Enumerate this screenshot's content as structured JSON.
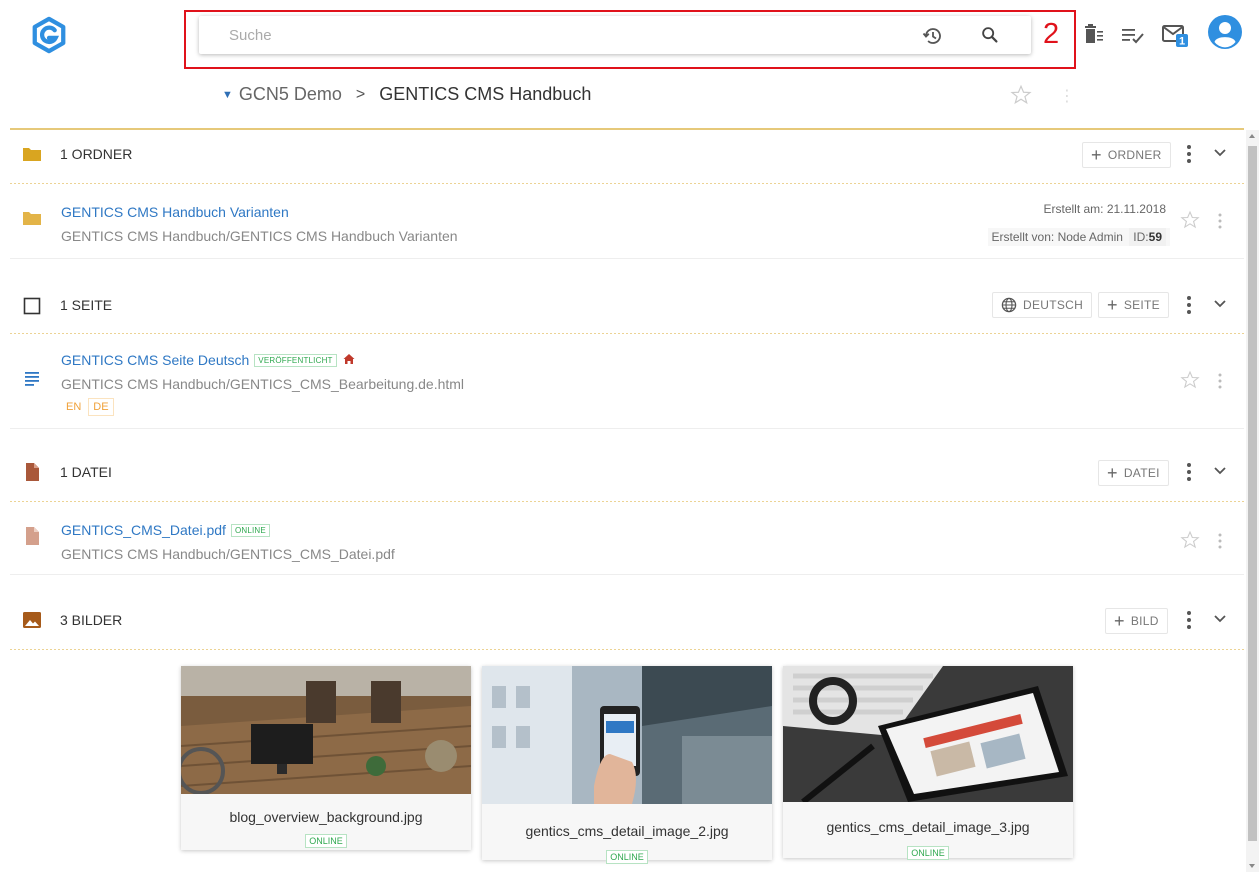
{
  "header": {
    "search_placeholder": "Suche",
    "callout_number": "2",
    "messages_count": "1"
  },
  "breadcrumb": {
    "root": "GCN5 Demo",
    "current": "GENTICS CMS Handbuch"
  },
  "sections": {
    "folders": {
      "title": "1 ORDNER",
      "add_label": "ORDNER",
      "items": [
        {
          "title": "GENTICS CMS Handbuch Varianten",
          "path": "GENTICS CMS Handbuch/GENTICS CMS Handbuch Varianten",
          "created_at": "Erstellt am: 21.11.2018",
          "created_by": "Erstellt von: Node Admin",
          "id_label": "ID:",
          "id_value": "59"
        }
      ]
    },
    "pages": {
      "title": "1 SEITE",
      "language_label": "DEUTSCH",
      "add_label": "SEITE",
      "items": [
        {
          "title": "GENTICS CMS Seite Deutsch",
          "status": "VERÖFFENTLICHT",
          "path": "GENTICS CMS Handbuch/GENTICS_CMS_Bearbeitung.de.html",
          "languages": [
            "EN",
            "DE"
          ]
        }
      ]
    },
    "files": {
      "title": "1 DATEI",
      "add_label": "DATEI",
      "items": [
        {
          "title": "GENTICS_CMS_Datei.pdf",
          "status": "ONLINE",
          "path": "GENTICS CMS Handbuch/GENTICS_CMS_Datei.pdf"
        }
      ]
    },
    "images": {
      "title": "3 BILDER",
      "add_label": "BILD",
      "items": [
        {
          "name": "blog_overview_background.jpg",
          "status": "ONLINE"
        },
        {
          "name": "gentics_cms_detail_image_2.jpg",
          "status": "ONLINE"
        },
        {
          "name": "gentics_cms_detail_image_3.jpg",
          "status": "ONLINE"
        }
      ]
    }
  },
  "colors": {
    "brand": "#2f8fe0",
    "link": "#2f78c4",
    "folder": "#d9a520",
    "file": "#a9583a",
    "image": "#a65a1a",
    "online": "#2fa84f",
    "callout": "#e0121b"
  },
  "icons": {
    "logo": "gentics-logo-icon",
    "history": "history-icon",
    "search": "search-icon",
    "wastebin": "wastebin-icon",
    "tasks": "tasks-icon",
    "messages": "messages-icon",
    "user": "user-avatar-icon"
  }
}
